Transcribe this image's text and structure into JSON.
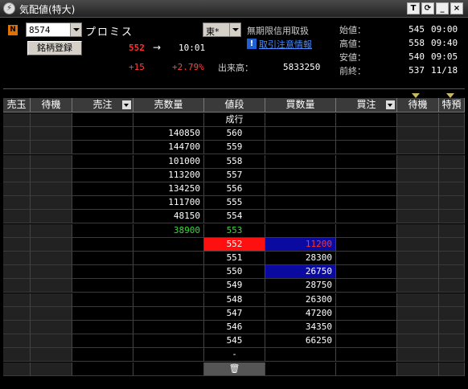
{
  "window": {
    "title": "気配値(特大)",
    "buttons": {
      "topmost": "T",
      "refresh": "⟳",
      "minimize": "_",
      "close": "×"
    }
  },
  "header": {
    "market_badge": "N",
    "code": "8574",
    "name": "プロミス",
    "register_button": "銘柄登録",
    "market_select": "東*",
    "margin_note": "無期限信用取扱",
    "notice_icon": "!",
    "notice_link": "取引注意情報",
    "current_price": "552",
    "arrow": "→",
    "current_time": "10:01",
    "change": "+15",
    "change_pct": "+2.79%",
    "volume_label": "出来高：",
    "volume": "5833250"
  },
  "ohlc": [
    {
      "label": "始値：",
      "price": "545",
      "time": "09:00"
    },
    {
      "label": "高値：",
      "price": "558",
      "time": "09:40"
    },
    {
      "label": "安値：",
      "price": "540",
      "time": "09:05"
    },
    {
      "label": "前終：",
      "price": "537",
      "time": "11/18"
    }
  ],
  "columns": [
    "売玉",
    "待機",
    "売注",
    "売数量",
    "値段",
    "買数量",
    "買注",
    "待機",
    "特預"
  ],
  "board": {
    "market_order_label": "成行",
    "ask_rows": [
      {
        "qty": "140850",
        "price": "560"
      },
      {
        "qty": "144700",
        "price": "559"
      },
      {
        "qty": "101000",
        "price": "558"
      },
      {
        "qty": "113200",
        "price": "557"
      },
      {
        "qty": "134250",
        "price": "556"
      },
      {
        "qty": "111700",
        "price": "555"
      },
      {
        "qty": "48150",
        "price": "554"
      },
      {
        "qty": "38900",
        "price": "553"
      }
    ],
    "bid_rows": [
      {
        "price": "552",
        "qty": "11200"
      },
      {
        "price": "551",
        "qty": "28300"
      },
      {
        "price": "550",
        "qty": "26750"
      },
      {
        "price": "549",
        "qty": "28750"
      },
      {
        "price": "548",
        "qty": "26300"
      },
      {
        "price": "547",
        "qty": "47200"
      },
      {
        "price": "546",
        "qty": "34350"
      },
      {
        "price": "545",
        "qty": "66250"
      }
    ],
    "bottom_price": "-",
    "trash_icon": "🗑"
  }
}
